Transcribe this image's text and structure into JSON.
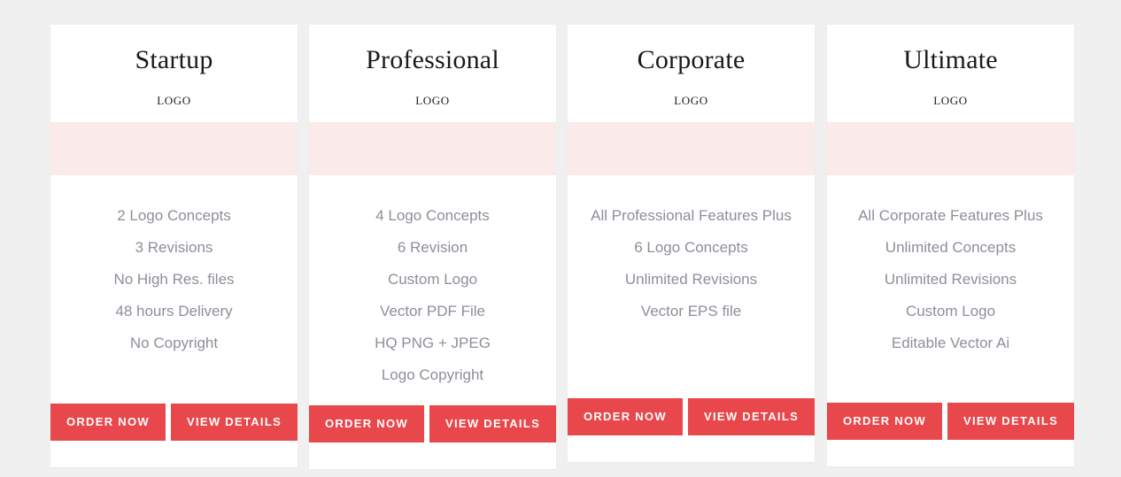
{
  "page": {
    "background_color": "#f0f0f0",
    "accent_color": "#e8474b",
    "band_color": "#fbeaea",
    "feature_text_color": "#8d8f99"
  },
  "plans": [
    {
      "name": "Startup",
      "logo_label": "LOGO",
      "features": [
        "2 Logo Concepts",
        "3 Revisions",
        "No High Res. files",
        "48 hours Delivery",
        "No Copyright"
      ],
      "order_label": "ORDER NOW",
      "details_label": "VIEW DETAILS"
    },
    {
      "name": "Professional",
      "logo_label": "LOGO",
      "features": [
        "4 Logo Concepts",
        "6 Revision",
        "Custom Logo",
        "Vector PDF File",
        "HQ PNG + JPEG",
        "Logo Copyright"
      ],
      "order_label": "ORDER NOW",
      "details_label": "VIEW DETAILS"
    },
    {
      "name": "Corporate",
      "logo_label": "LOGO",
      "features": [
        "All Professional Features Plus",
        "6 Logo Concepts",
        "Unlimited Revisions",
        "Vector EPS file"
      ],
      "order_label": "ORDER NOW",
      "details_label": "VIEW DETAILS"
    },
    {
      "name": "Ultimate",
      "logo_label": "LOGO",
      "features": [
        "All Corporate Features Plus",
        "Unlimited Concepts",
        "Unlimited Revisions",
        "Custom Logo",
        "Editable Vector Ai"
      ],
      "order_label": "ORDER NOW",
      "details_label": "VIEW DETAILS"
    }
  ]
}
